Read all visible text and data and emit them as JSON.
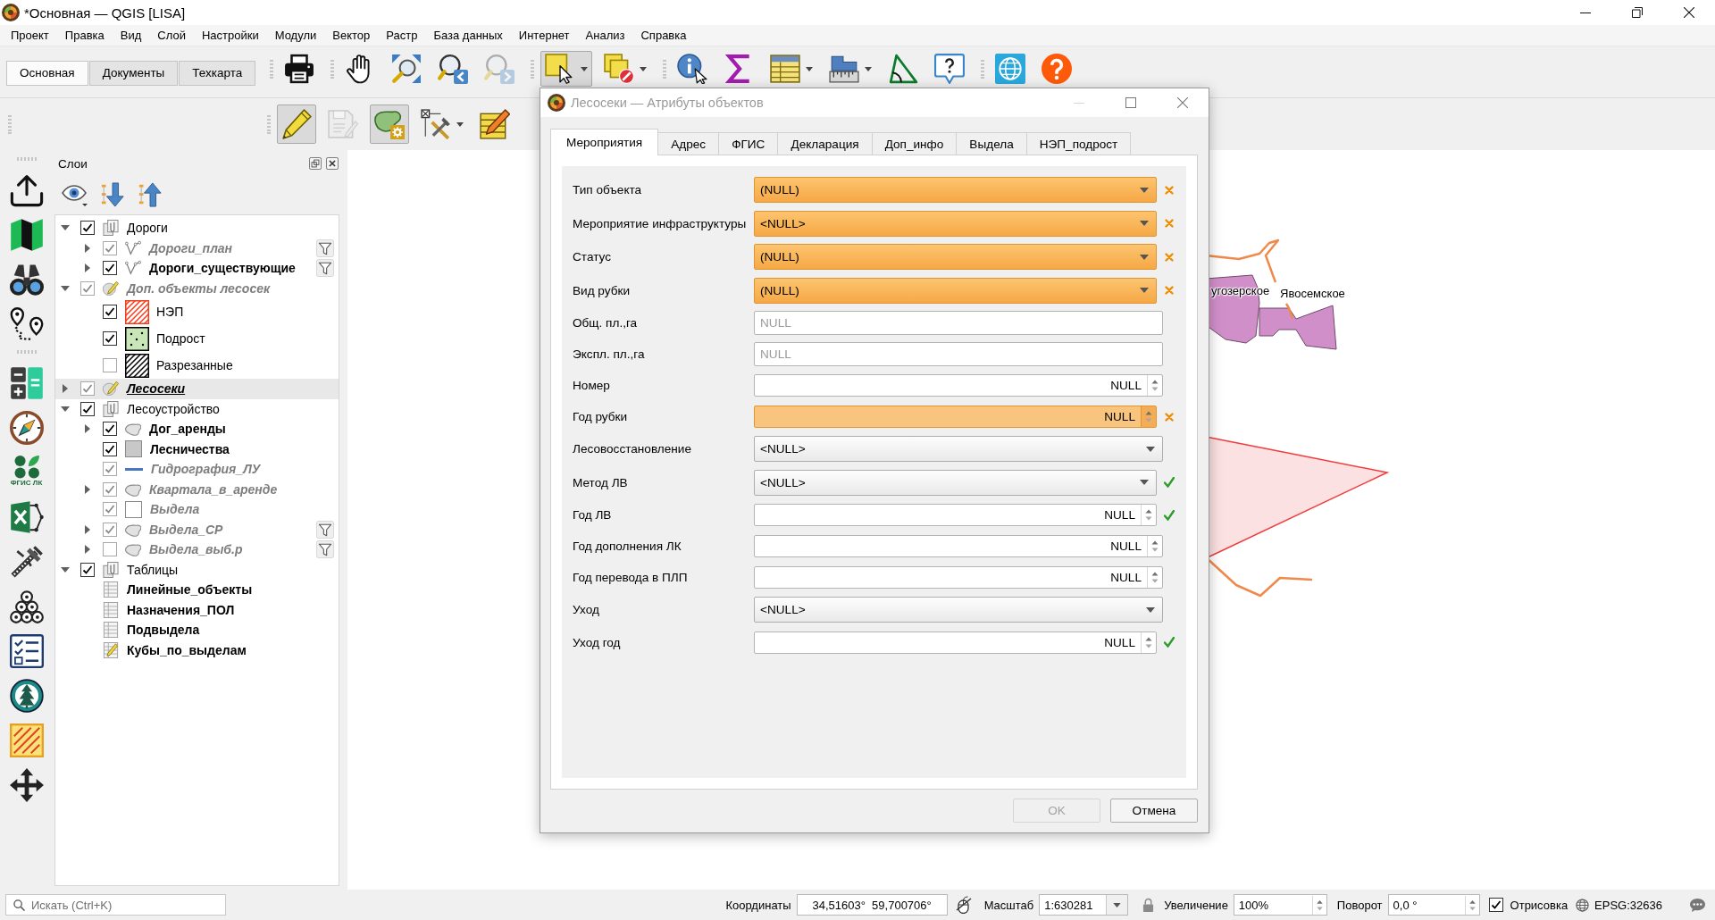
{
  "window": {
    "title": "*Основная — QGIS [LISA]"
  },
  "menu": [
    "Проект",
    "Правка",
    "Вид",
    "Слой",
    "Настройки",
    "Модули",
    "Вектор",
    "Растр",
    "База данных",
    "Интернет",
    "Анализ",
    "Справка"
  ],
  "ribbon_tabs": [
    {
      "label": "Основная",
      "selected": true
    },
    {
      "label": "Документы",
      "selected": false
    },
    {
      "label": "Техкарта",
      "selected": false
    }
  ],
  "toolbars": {
    "top_row": [
      [
        {
          "kind": "print",
          "pressed": false,
          "disabled": false,
          "menu": false
        }
      ],
      [
        {
          "kind": "pan",
          "pressed": false,
          "disabled": false,
          "menu": false
        },
        {
          "kind": "zoomfull",
          "pressed": false,
          "disabled": false,
          "menu": false
        },
        {
          "kind": "zoomlast",
          "pressed": false,
          "disabled": false,
          "menu": false
        },
        {
          "kind": "zoomnext",
          "pressed": false,
          "disabled": true,
          "menu": false
        }
      ],
      [
        {
          "kind": "select",
          "pressed": true,
          "disabled": false,
          "menu": true
        },
        {
          "kind": "deselect",
          "pressed": false,
          "disabled": false,
          "menu": true
        }
      ],
      [
        {
          "kind": "identify",
          "pressed": false,
          "disabled": false,
          "menu": false
        },
        {
          "kind": "statistics",
          "pressed": false,
          "disabled": false,
          "menu": false
        },
        {
          "kind": "attributes",
          "pressed": false,
          "disabled": false,
          "menu": true
        },
        {
          "kind": "measure",
          "pressed": false,
          "disabled": false,
          "menu": true
        },
        {
          "kind": "angle",
          "pressed": false,
          "disabled": false,
          "menu": false
        },
        {
          "kind": "tips",
          "pressed": false,
          "disabled": false,
          "menu": false
        }
      ],
      [
        {
          "kind": "web",
          "pressed": false,
          "disabled": false,
          "menu": false
        },
        {
          "kind": "help",
          "pressed": false,
          "disabled": false,
          "menu": false
        }
      ]
    ],
    "second_row": [
      {
        "kind": "edit",
        "pressed": true,
        "disabled": false,
        "menu": false
      },
      {
        "kind": "save",
        "pressed": false,
        "disabled": true,
        "menu": false
      },
      {
        "kind": "digitize",
        "pressed": true,
        "disabled": false,
        "menu": false
      },
      {
        "kind": "vertex",
        "pressed": false,
        "disabled": false,
        "menu": true
      },
      {
        "kind": "edittable",
        "pressed": false,
        "disabled": false,
        "menu": false
      }
    ]
  },
  "side_toolbar": [
    [
      {
        "kind": "upload"
      },
      {
        "kind": "map"
      },
      {
        "kind": "binoculars"
      },
      {
        "kind": "route"
      }
    ],
    [
      {
        "kind": "calculator"
      },
      {
        "kind": "compass"
      },
      {
        "kind": "fgis",
        "label": "ФГИС ЛК"
      },
      {
        "kind": "excel"
      },
      {
        "kind": "caliper"
      },
      {
        "kind": "logs"
      },
      {
        "kind": "checklist"
      },
      {
        "kind": "tree"
      },
      {
        "kind": "hatch"
      },
      {
        "kind": "move"
      }
    ]
  ],
  "layers_panel": {
    "title": "Слои",
    "tree": [
      {
        "label": "Дороги",
        "kind": "group",
        "checked": true,
        "expanded": true,
        "bold": false,
        "dimmed": false,
        "current": false,
        "filtered": false,
        "selected": false,
        "children": [
          {
            "label": "Дороги_план",
            "kind": "line",
            "checked": true,
            "expanded": false,
            "bold": true,
            "dimmed": true,
            "current": false,
            "filtered": true,
            "selected": false
          },
          {
            "label": "Дороги_существующие",
            "kind": "line",
            "checked": true,
            "expanded": false,
            "bold": true,
            "dimmed": false,
            "current": false,
            "filtered": true,
            "selected": false
          }
        ]
      },
      {
        "label": "Доп. объекты лесосек",
        "kind": "editlayer",
        "checked": true,
        "expanded": true,
        "bold": true,
        "dimmed": true,
        "current": false,
        "filtered": false,
        "selected": false,
        "children": [
          {
            "label": "НЭП",
            "kind": "hatch",
            "color": "#f53b1a",
            "checked": true,
            "bold": false,
            "dimmed": false,
            "current": false,
            "filtered": false,
            "selected": false
          },
          {
            "label": "Подрост",
            "kind": "dots",
            "color": "#c8e6b8",
            "checked": true,
            "bold": false,
            "dimmed": false,
            "current": false,
            "filtered": false,
            "selected": false
          },
          {
            "label": "Разрезанные",
            "kind": "hatch",
            "color": "#000000",
            "checked": false,
            "bold": false,
            "dimmed": false,
            "current": false,
            "filtered": false,
            "selected": false
          }
        ]
      },
      {
        "label": "Лесосеки",
        "kind": "editlayer",
        "checked": true,
        "expanded": false,
        "bold": true,
        "dimmed": false,
        "current": true,
        "filtered": false,
        "selected": true
      },
      {
        "label": "Лесоустройство",
        "kind": "group",
        "checked": true,
        "expanded": true,
        "bold": false,
        "dimmed": false,
        "current": false,
        "filtered": false,
        "selected": false,
        "children": [
          {
            "label": "Дог_аренды",
            "kind": "polygon",
            "checked": true,
            "expanded": false,
            "bold": true,
            "dimmed": false,
            "current": false,
            "filtered": false,
            "selected": false
          },
          {
            "label": "Лесничества",
            "kind": "fill",
            "color": "#c8c8c8",
            "checked": true,
            "bold": true,
            "dimmed": false,
            "current": false,
            "filtered": false,
            "selected": false
          },
          {
            "label": "Гидрография_ЛУ",
            "kind": "stroke",
            "color": "#4a76c2",
            "checked": true,
            "bold": true,
            "dimmed": true,
            "current": false,
            "filtered": false,
            "selected": false
          },
          {
            "label": "Квартала_в_аренде",
            "kind": "polygon",
            "checked": true,
            "expanded": false,
            "bold": true,
            "dimmed": true,
            "current": false,
            "filtered": false,
            "selected": false
          },
          {
            "label": "Выдела",
            "kind": "fill",
            "color": "#ffffff",
            "checked": true,
            "bold": true,
            "dimmed": true,
            "current": false,
            "filtered": false,
            "selected": false
          },
          {
            "label": "Выдела_СР",
            "kind": "polygon",
            "checked": true,
            "expanded": false,
            "bold": true,
            "dimmed": true,
            "current": false,
            "filtered": true,
            "selected": false
          },
          {
            "label": "Выдела_выб.р",
            "kind": "polygon",
            "checked": false,
            "expanded": false,
            "bold": true,
            "dimmed": true,
            "current": false,
            "filtered": true,
            "selected": false
          }
        ]
      },
      {
        "label": "Таблицы",
        "kind": "group",
        "checked": true,
        "expanded": true,
        "bold": false,
        "dimmed": false,
        "current": false,
        "filtered": false,
        "selected": false,
        "children": [
          {
            "label": "Линейные_объекты",
            "kind": "table",
            "bold": true,
            "dimmed": false,
            "current": false,
            "filtered": false,
            "selected": false
          },
          {
            "label": "Назначения_ПОЛ",
            "kind": "table",
            "bold": true,
            "dimmed": false,
            "current": false,
            "filtered": false,
            "selected": false
          },
          {
            "label": "Подвыдела",
            "kind": "table",
            "bold": true,
            "dimmed": false,
            "current": false,
            "filtered": false,
            "selected": false
          },
          {
            "label": "Кубы_по_выделам",
            "kind": "edittable",
            "bold": true,
            "dimmed": false,
            "current": false,
            "filtered": false,
            "selected": false
          }
        ]
      }
    ]
  },
  "map": {
    "labels": [
      {
        "text": "угозерское"
      },
      {
        "text": "Явосемское"
      }
    ]
  },
  "dialog": {
    "title": "Лесосеки — Атрибуты объектов",
    "tabs": [
      {
        "label": "Мероприятия",
        "selected": true
      },
      {
        "label": "Адрес",
        "selected": false
      },
      {
        "label": "ФГИС",
        "selected": false
      },
      {
        "label": "Декларация",
        "selected": false
      },
      {
        "label": "Доп_инфо",
        "selected": false
      },
      {
        "label": "Выдела",
        "selected": false
      },
      {
        "label": "НЭП_подрост",
        "selected": false
      }
    ],
    "fields": [
      {
        "label": "Тип объекта",
        "kind": "combo",
        "value": "(NULL)",
        "constrained": true,
        "valid": false
      },
      {
        "label": "Мероприятие инфраструктуры",
        "kind": "combo",
        "value": "<NULL>",
        "constrained": true,
        "valid": false
      },
      {
        "label": "Статус",
        "kind": "combo",
        "value": "(NULL)",
        "constrained": true,
        "valid": false
      },
      {
        "label": "Вид рубки",
        "kind": "combo",
        "value": "(NULL)",
        "constrained": true,
        "valid": false
      },
      {
        "label": "Общ. пл.,га",
        "kind": "text",
        "placeholder": "NULL",
        "constrained": false
      },
      {
        "label": "Экспл. пл.,га",
        "kind": "text",
        "placeholder": "NULL",
        "constrained": false
      },
      {
        "label": "Номер",
        "kind": "spin",
        "value": "NULL",
        "constrained": false
      },
      {
        "label": "Год рубки",
        "kind": "spin",
        "value": "NULL",
        "constrained": true,
        "valid": false
      },
      {
        "label": "Лесовосстановление",
        "kind": "combo",
        "value": "<NULL>",
        "constrained": false
      },
      {
        "label": "Метод ЛВ",
        "kind": "combo",
        "value": "<NULL>",
        "constrained": true,
        "valid": true
      },
      {
        "label": "Год ЛВ",
        "kind": "spin",
        "value": "NULL",
        "constrained": true,
        "valid": true
      },
      {
        "label": "Год дополнения ЛК",
        "kind": "spin",
        "value": "NULL",
        "constrained": false
      },
      {
        "label": "Год перевода в ПЛП",
        "kind": "spin",
        "value": "NULL",
        "constrained": false
      },
      {
        "label": "Уход",
        "kind": "combo",
        "value": "<NULL>",
        "constrained": false
      },
      {
        "label": "Уход год",
        "kind": "spin",
        "value": "NULL",
        "constrained": true,
        "valid": true
      }
    ],
    "buttons": [
      {
        "label": "OK",
        "disabled": true
      },
      {
        "label": "Отмена",
        "disabled": false
      }
    ]
  },
  "status_bar": {
    "search": {
      "placeholder": "Искать (Ctrl+K)"
    },
    "coordinates": {
      "label": "Координаты",
      "value": "34,51603°  59,700706°"
    },
    "scale": {
      "label": "Масштаб",
      "value": "1:630281"
    },
    "magnifier": {
      "label": "Увеличение",
      "value": "100%"
    },
    "rotation": {
      "label": "Поворот",
      "value": "0,0 °"
    },
    "render": {
      "label": "Отрисовка",
      "checked": true
    },
    "crs": "EPSG:32636"
  }
}
